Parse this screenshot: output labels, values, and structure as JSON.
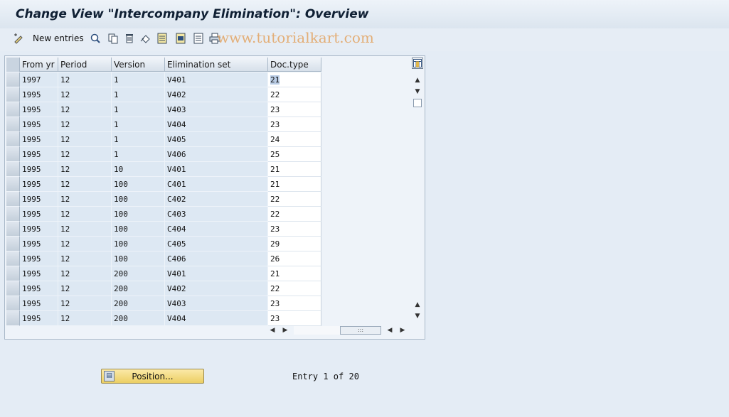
{
  "window": {
    "title": "Change View \"Intercompany Elimination\": Overview",
    "watermark": "www.tutorialkart.com"
  },
  "toolbar": {
    "icons": [
      "edit-toggle-icon",
      "display-details-icon",
      "copy-as-icon",
      "delete-icon",
      "undo-change-icon",
      "select-all-icon",
      "select-block-icon",
      "deselect-all-icon",
      "print-icon"
    ],
    "new_entries_label": "New entries"
  },
  "table": {
    "columns": [
      "From yr",
      "Period",
      "Version",
      "Elimination set",
      "Doc.type"
    ],
    "rows": [
      [
        "1997",
        "12",
        "1",
        "V401",
        "21"
      ],
      [
        "1995",
        "12",
        "1",
        "V402",
        "22"
      ],
      [
        "1995",
        "12",
        "1",
        "V403",
        "23"
      ],
      [
        "1995",
        "12",
        "1",
        "V404",
        "23"
      ],
      [
        "1995",
        "12",
        "1",
        "V405",
        "24"
      ],
      [
        "1995",
        "12",
        "1",
        "V406",
        "25"
      ],
      [
        "1995",
        "12",
        "10",
        "V401",
        "21"
      ],
      [
        "1995",
        "12",
        "100",
        "C401",
        "21"
      ],
      [
        "1995",
        "12",
        "100",
        "C402",
        "22"
      ],
      [
        "1995",
        "12",
        "100",
        "C403",
        "22"
      ],
      [
        "1995",
        "12",
        "100",
        "C404",
        "23"
      ],
      [
        "1995",
        "12",
        "100",
        "C405",
        "29"
      ],
      [
        "1995",
        "12",
        "100",
        "C406",
        "26"
      ],
      [
        "1995",
        "12",
        "200",
        "V401",
        "21"
      ],
      [
        "1995",
        "12",
        "200",
        "V402",
        "22"
      ],
      [
        "1995",
        "12",
        "200",
        "V403",
        "23"
      ],
      [
        "1995",
        "12",
        "200",
        "V404",
        "23"
      ]
    ],
    "horizontal_scroll_grip": ":::"
  },
  "footer": {
    "position_button_label": "Position...",
    "entry_text": "Entry 1 of 20"
  }
}
